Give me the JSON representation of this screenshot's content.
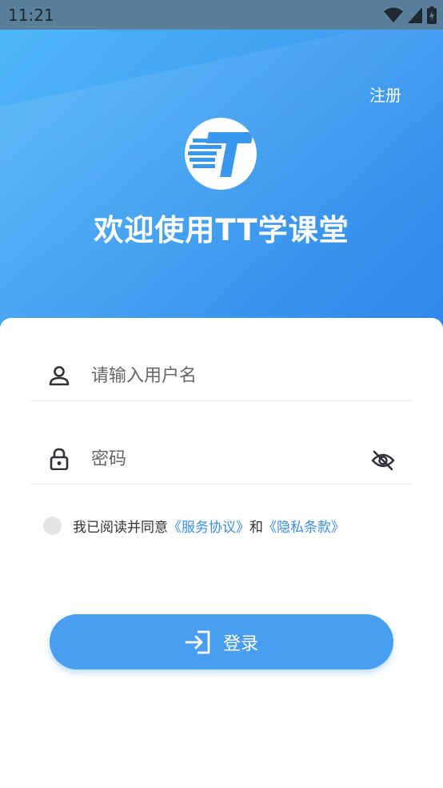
{
  "status_bar": {
    "time": "11:21",
    "icons": [
      "wifi-icon",
      "cellular-signal-icon",
      "battery-charging-icon"
    ]
  },
  "header": {
    "register_label": "注册",
    "logo_icon": "tt-logo-icon",
    "welcome_text": "欢迎使用TT学课堂"
  },
  "form": {
    "username": {
      "placeholder": "请输入用户名",
      "value": "",
      "icon": "user-icon"
    },
    "password": {
      "placeholder": "密码",
      "value": "",
      "icon": "lock-icon",
      "toggle_icon": "eye-off-icon"
    },
    "agreement": {
      "checked": false,
      "prefix": "我已阅读并同意",
      "service_link": "《服务协议》",
      "conjunction": "和",
      "privacy_link": "《隐私条款》"
    },
    "login_button": {
      "label": "登录",
      "icon": "login-icon"
    }
  },
  "colors": {
    "accent": "#4a9ef1",
    "link": "#3b8fe0",
    "hero_start": "#4fb6f8",
    "hero_end": "#2f86ea",
    "status_bar": "#5a7f9a"
  }
}
